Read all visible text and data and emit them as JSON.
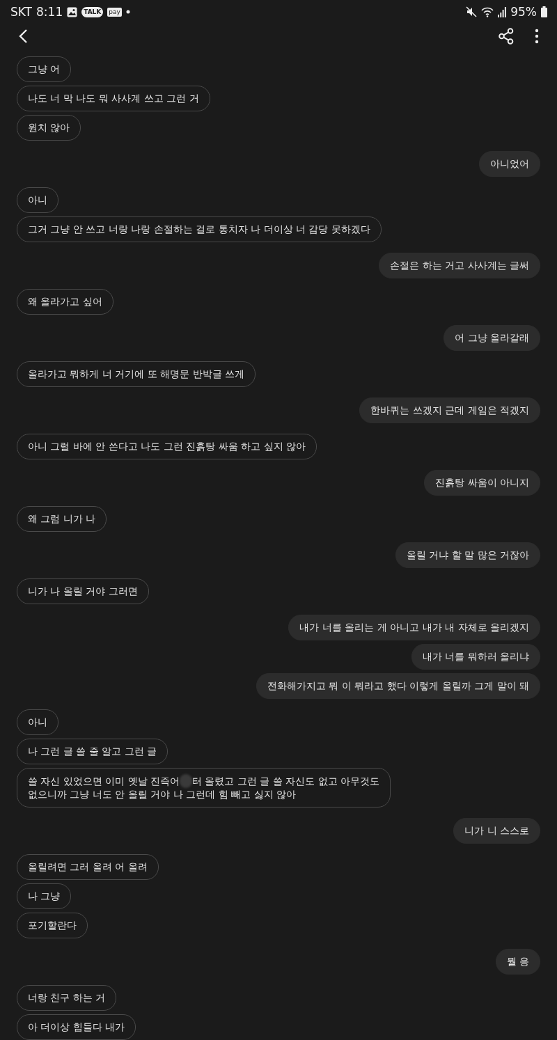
{
  "status_bar": {
    "carrier": "SKT",
    "time": "8:11",
    "talk_label": "TALK",
    "pay_label": "pay",
    "battery": "95%"
  },
  "messages": [
    {
      "kind": "received",
      "text": "그냥 어"
    },
    {
      "kind": "received",
      "text": "나도 너 막 나도 뭐 사사계 쓰고 그런 거"
    },
    {
      "kind": "received",
      "text": "원치 않아"
    },
    {
      "kind": "sent",
      "text": "아니었어"
    },
    {
      "kind": "received",
      "text": "아니"
    },
    {
      "kind": "received",
      "text": "그거 그냥 안 쓰고 너랑 나랑 손절하는 걸로 통치자 나 더이상 너 감당 못하겠다"
    },
    {
      "kind": "sent",
      "text": "손절은 하는 거고 사사계는 글써"
    },
    {
      "kind": "received",
      "text": "왜 올라가고 싶어"
    },
    {
      "kind": "sent",
      "text": "어 그냥 올라갈래"
    },
    {
      "kind": "received",
      "text": "올라가고 뭐하게 너 거기에 또 해명문 반박글 쓰게"
    },
    {
      "kind": "sent",
      "text": "한바퀴는 쓰겠지 근데 게임은 적겠지"
    },
    {
      "kind": "received",
      "text": "아니 그럴 바에 안 쓴다고 나도 그런 진흙탕 싸움 하고 싶지 않아"
    },
    {
      "kind": "sent",
      "text": "진흙탕 싸움이 아니지"
    },
    {
      "kind": "received",
      "text": "왜 그럼 니가 나"
    },
    {
      "kind": "sent",
      "text": "올릴 거냐 할 말 많은 거잖아"
    },
    {
      "kind": "received",
      "text": "니가 나 올릴 거야 그러면"
    },
    {
      "kind": "sent",
      "text": "내가 너를 올리는 게 아니고 내가 내 자체로 올리겠지"
    },
    {
      "kind": "sent",
      "text": "내가 너를 뭐하러 올리냐"
    },
    {
      "kind": "sent",
      "text": "전화해가지고 뭐 이 뭐라고 했다 이렇게 올릴까 그게 말이 돼"
    },
    {
      "kind": "received",
      "text": "아니"
    },
    {
      "kind": "received",
      "text": "나 그런 글 쓸 줄 알고 그런 글"
    },
    {
      "kind": "received",
      "text": "쓸 자신 있었으면 이미 옛날 진즉어",
      "redacted": true,
      "text_after": "터 올렸고 그런 글 쓸 자신도 없고 아무것도",
      "text_line2": "없으니까 그냥 너도 안 올릴 거야 나 그런데 힘 빼고 싫지 않아"
    },
    {
      "kind": "sent",
      "text": "니가 니 스스로"
    },
    {
      "kind": "received",
      "text": "올릴려면 그러 올려 어 올려"
    },
    {
      "kind": "received",
      "text": "나 그냥"
    },
    {
      "kind": "received",
      "text": "포기할란다"
    },
    {
      "kind": "sent",
      "text": "뭘 응"
    },
    {
      "kind": "received",
      "text": "너랑 친구 하는 거"
    },
    {
      "kind": "received",
      "text": "아 더이상 힘들다 내가"
    }
  ]
}
